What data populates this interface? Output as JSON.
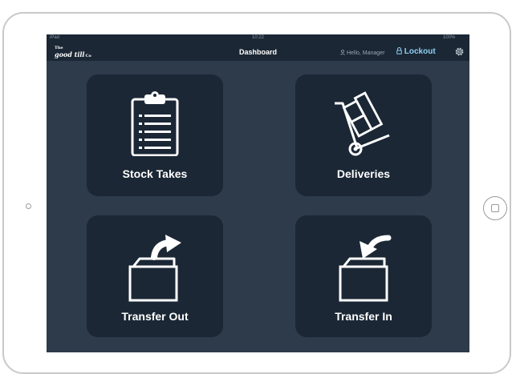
{
  "status_bar": {
    "carrier": "iPad",
    "time": "10:22",
    "battery": "100%"
  },
  "header": {
    "logo_top": "The",
    "logo_main": "good till",
    "logo_suffix": "Co",
    "title": "Dashboard",
    "greeting": "Hello, Manager",
    "lockout_label": "Lockout"
  },
  "tiles": [
    {
      "label": "Stock Takes",
      "icon": "clipboard-icon"
    },
    {
      "label": "Deliveries",
      "icon": "hand-truck-icon"
    },
    {
      "label": "Transfer Out",
      "icon": "box-arrow-out-icon"
    },
    {
      "label": "Transfer In",
      "icon": "box-arrow-in-icon"
    }
  ],
  "colors": {
    "background": "#2d3b4a",
    "tile": "#1b2735",
    "accent": "#8fd0f2",
    "text": "#ffffff"
  }
}
